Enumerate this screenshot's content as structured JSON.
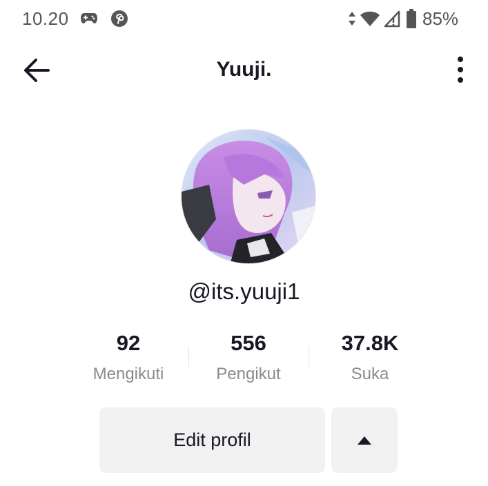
{
  "status_bar": {
    "time": "10.20",
    "battery_percent": "85%",
    "icons": [
      "gamepad-icon",
      "pinterest-icon",
      "data-arrows-icon",
      "wifi-icon",
      "signal-icon",
      "battery-icon"
    ]
  },
  "header": {
    "title": "Yuuji.",
    "back_icon": "arrow-left-icon",
    "more_icon": "more-vertical-icon"
  },
  "profile": {
    "username": "@its.yuuji1",
    "avatar": "anime-avatar"
  },
  "stats": [
    {
      "value": "92",
      "label": "Mengikuti"
    },
    {
      "value": "556",
      "label": "Pengikut"
    },
    {
      "value": "37.8K",
      "label": "Suka"
    }
  ],
  "actions": {
    "edit_label": "Edit profil",
    "toggle_icon": "triangle-up-icon"
  },
  "colors": {
    "text_primary": "#161823",
    "text_secondary": "#8a8b91",
    "button_bg": "#f1f1f2"
  }
}
